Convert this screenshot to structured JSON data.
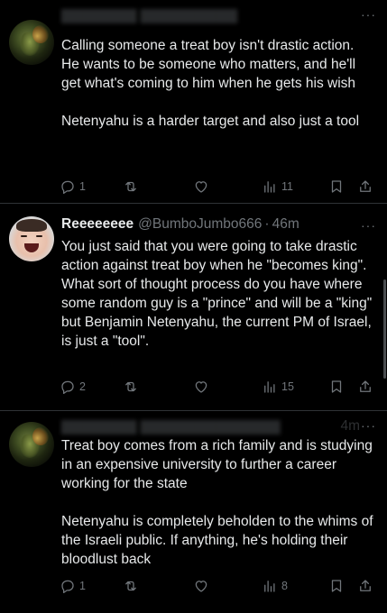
{
  "tweets": [
    {
      "author": {
        "name": "",
        "handle": "",
        "time": ""
      },
      "text": "Calling someone a treat boy isn't drastic action. He wants to be someone who matters, and he'll get what's coming to him when he gets his wish\n\nNetenyahu is a harder target and also just a tool",
      "counts": {
        "replies": "1",
        "retweets": "",
        "likes": "",
        "views": "11"
      }
    },
    {
      "author": {
        "name": "Reeeeeeee",
        "handle": "@BumboJumbo666",
        "sep": "·",
        "time": "46m"
      },
      "text": "You just said that you were going to take drastic action against treat boy when he \"becomes king\". What sort of thought process do you have where some random guy is a \"prince\" and will be a \"king\" but Benjamin Netenyahu, the current PM of Israel, is just a \"tool\".",
      "counts": {
        "replies": "2",
        "retweets": "",
        "likes": "",
        "views": "15"
      }
    },
    {
      "author": {
        "name": "",
        "handle": "",
        "time": "4m"
      },
      "text": "Treat boy comes from a rich family and is studying in an expensive university to further a career working for the state\n\nNetenyahu is completely beholden to the whims of the Israeli public. If anything, he's holding their bloodlust back",
      "counts": {
        "replies": "1",
        "retweets": "",
        "likes": "",
        "views": "8"
      }
    }
  ],
  "more_glyph": "···",
  "icons": {
    "reply": "reply-icon",
    "retweet": "retweet-icon",
    "like": "heart-icon",
    "views": "views-chart-icon",
    "bookmark": "bookmark-icon",
    "share": "share-icon"
  },
  "colors": {
    "background": "#000000",
    "text": "#e7e9ea",
    "muted": "#71767b",
    "divider": "#2f3336"
  }
}
